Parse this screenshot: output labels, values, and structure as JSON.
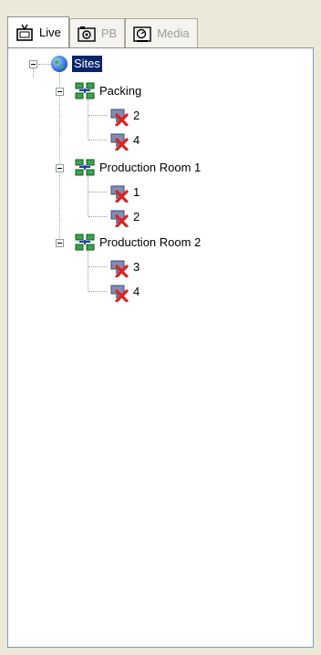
{
  "tabs": [
    {
      "label": "Live",
      "icon": "tv-icon",
      "active": true
    },
    {
      "label": "PB",
      "icon": "camera-playback-icon",
      "active": false
    },
    {
      "label": "Media",
      "icon": "media-icon",
      "active": false
    }
  ],
  "tree": {
    "root": {
      "label": "Sites",
      "icon": "globe-icon",
      "selected": true
    },
    "groups": [
      {
        "label": "Packing",
        "icon": "network-group-icon",
        "cameras": [
          "2",
          "4"
        ]
      },
      {
        "label": "Production Room 1",
        "icon": "network-group-icon",
        "cameras": [
          "1",
          "2"
        ]
      },
      {
        "label": "Production Room 2",
        "icon": "network-group-icon",
        "cameras": [
          "3",
          "4"
        ]
      }
    ],
    "camera_icon": "camera-offline-icon"
  },
  "colors": {
    "selection": "#0a246a",
    "offline_x": "#e02020",
    "panel_border": "#7f9db9"
  }
}
